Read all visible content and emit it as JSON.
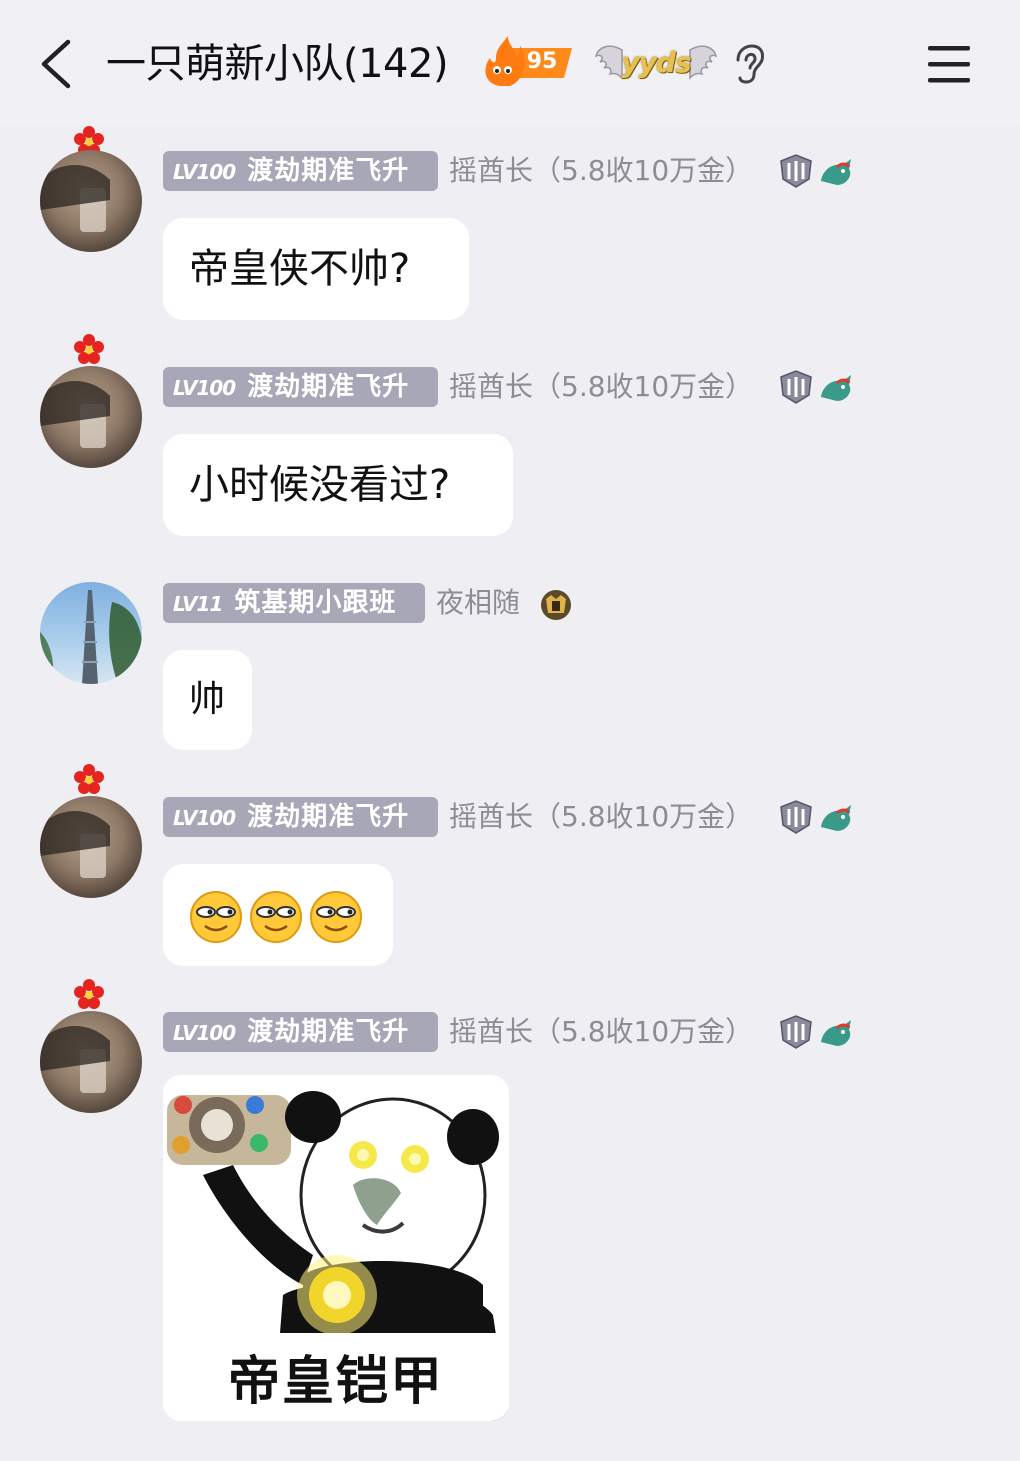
{
  "header": {
    "title": "一只萌新小队(142)",
    "fire_count": "95",
    "yyds_label": "yyds"
  },
  "messages": [
    {
      "level": "LV100",
      "rank": "渡劫期准飞升",
      "sender": "摇酋长（5.8收10万金）",
      "text": "帝皇侠不帅?"
    },
    {
      "level": "LV100",
      "rank": "渡劫期准飞升",
      "sender": "摇酋长（5.8收10万金）",
      "text": "小时候没看过?"
    },
    {
      "level": "LV11",
      "rank": "筑基期小跟班",
      "sender": "夜相随",
      "text": "帅"
    },
    {
      "level": "LV100",
      "rank": "渡劫期准飞升",
      "sender": "摇酋长（5.8收10万金）",
      "emoji": [
        "smirk-emoji",
        "smirk-emoji",
        "smirk-emoji"
      ]
    },
    {
      "level": "LV100",
      "rank": "渡劫期准飞升",
      "sender": "摇酋长（5.8收10万金）",
      "sticker_caption": "帝皇铠甲"
    }
  ],
  "icons": {
    "back": "back-arrow-icon",
    "fire": "fire-icon",
    "wings": "wings-icon",
    "ear": "ear-icon",
    "menu": "menu-icon",
    "shield": "shield-badge-icon",
    "dragon": "dragon-badge-icon",
    "flower": "red-flower-icon"
  },
  "colors": {
    "background": "#efeef3",
    "level_tag": "#a8a7b8",
    "sender_text": "#8c8c94",
    "bubble": "#ffffff",
    "fire": "#ff8a1a"
  }
}
